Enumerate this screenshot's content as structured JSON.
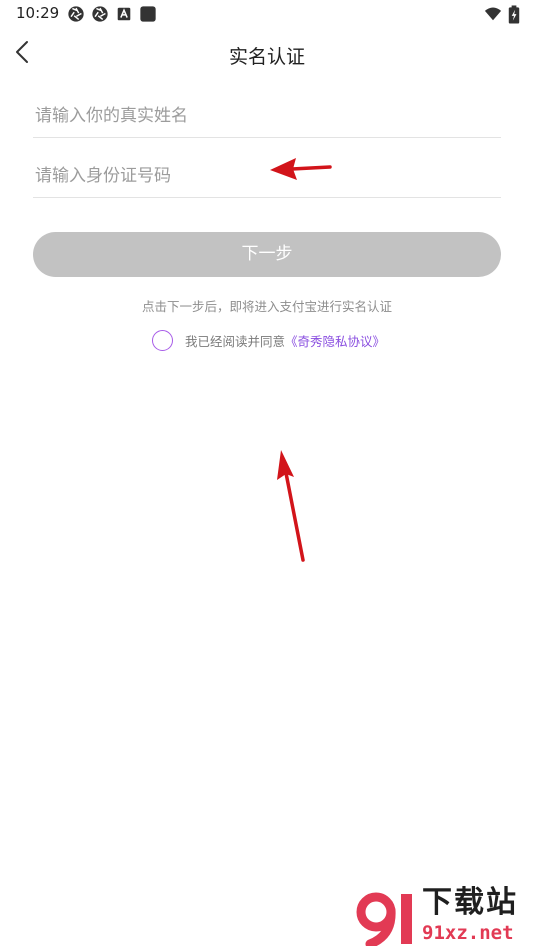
{
  "status_bar": {
    "time": "10:29",
    "left_icons": [
      "aperture-icon",
      "aperture-icon",
      "a-badge-icon",
      "square-app-icon"
    ],
    "right_icons": [
      "wifi-icon",
      "battery-charging-icon"
    ]
  },
  "nav": {
    "title": "实名认证",
    "back_icon": "chevron-left-icon"
  },
  "form": {
    "name_field": {
      "value": "",
      "placeholder": "请输入你的真实姓名"
    },
    "id_field": {
      "value": "",
      "placeholder": "请输入身份证号码"
    },
    "next_label": "下一步",
    "hint": "点击下一步后，即将进入支付宝进行实名认证",
    "agreement": {
      "checked": false,
      "text": "我已经阅读并同意",
      "link": "《奇秀隐私协议》"
    }
  },
  "watermark": {
    "title": "下载站",
    "url": "91xz.net"
  },
  "colors": {
    "accent": "#8a4fe0",
    "checkbox_border": "#a75be8",
    "button_disabled": "#c2c2c2",
    "annotation_arrow": "#d2141a",
    "watermark_url": "#e23a54"
  }
}
